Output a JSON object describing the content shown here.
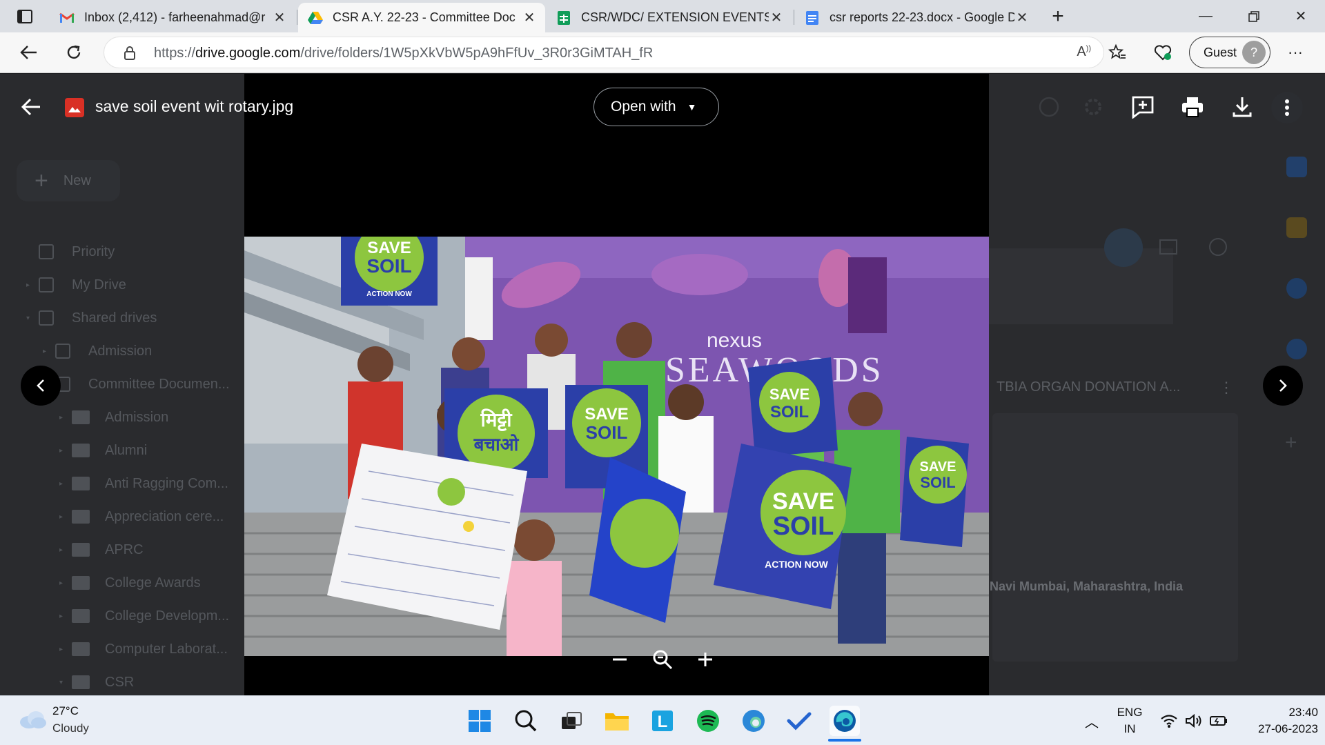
{
  "browser": {
    "tabs": [
      {
        "title": "Inbox (2,412) - farheenahmad@r",
        "icon": "gmail-icon",
        "active": false
      },
      {
        "title": "CSR A.Y. 22-23 - Committee Doc",
        "icon": "google-drive-icon",
        "active": true
      },
      {
        "title": "CSR/WDC/ EXTENSION EVENTS F",
        "icon": "google-sheets-icon",
        "active": false
      },
      {
        "title": "csr reports 22-23.docx - Google D",
        "icon": "google-docs-icon",
        "active": false
      }
    ],
    "url_prefix": "https://",
    "url_domain": "drive.google.com",
    "url_path": "/drive/folders/1W5pXkVbW5pA9hFfUv_3R0r3GiMTAH_fR",
    "profile_label": "Guest"
  },
  "drive": {
    "new_label": "New",
    "nav": [
      {
        "label": "Priority",
        "level": 0,
        "icon": "priority-icon"
      },
      {
        "label": "My Drive",
        "level": 0,
        "icon": "my-drive-icon"
      },
      {
        "label": "Shared drives",
        "level": 0,
        "icon": "shared-drives-icon"
      },
      {
        "label": "Admission",
        "level": 1,
        "icon": "shared-drive-icon"
      },
      {
        "label": "Committee Documen...",
        "level": 1,
        "icon": "shared-drive-icon"
      },
      {
        "label": "Admission",
        "level": 2,
        "icon": "folder-icon"
      },
      {
        "label": "Alumni",
        "level": 2,
        "icon": "folder-icon"
      },
      {
        "label": "Anti Ragging Com...",
        "level": 2,
        "icon": "folder-icon"
      },
      {
        "label": "Appreciation cere...",
        "level": 2,
        "icon": "folder-icon"
      },
      {
        "label": "APRC",
        "level": 2,
        "icon": "folder-icon"
      },
      {
        "label": "College Awards",
        "level": 2,
        "icon": "folder-icon"
      },
      {
        "label": "College Developm...",
        "level": 2,
        "icon": "folder-icon"
      },
      {
        "label": "Computer Laborat...",
        "level": 2,
        "icon": "folder-icon"
      },
      {
        "label": "CSR",
        "level": 2,
        "icon": "folder-icon"
      }
    ],
    "right_card_title": "TBIA ORGAN DONATION A...",
    "right_card_location": "Navi Mumbai, Maharashtra, India"
  },
  "viewer": {
    "file_name": "save soil event wit rotary.jpg",
    "open_with_label": "Open with",
    "photo_alt": "Group photo of volunteers holding Save Soil placards at Nexus Seawoods",
    "photo_texts": {
      "sign1_line1": "SAVE",
      "sign1_line2": "SOIL",
      "sign_action": "ACTION NOW",
      "hindi_line1": "मिट्टी",
      "hindi_line2": "बचाओ",
      "mall_brand": "nexus",
      "mall_name": "SEAWOODS"
    },
    "zoom_controls": [
      "zoom-out",
      "zoom-reset",
      "zoom-in"
    ]
  },
  "taskbar": {
    "temperature": "27°C",
    "condition": "Cloudy",
    "language_line1": "ENG",
    "language_line2": "IN",
    "time": "23:40",
    "date": "27-06-2023"
  },
  "colors": {
    "viewer_bg": "#000000",
    "drive_dim_bg": "#2a2b2e",
    "save_soil_green": "#8dc63f",
    "save_soil_blue": "#2b3fa8",
    "accent_blue": "#1a73e8"
  }
}
